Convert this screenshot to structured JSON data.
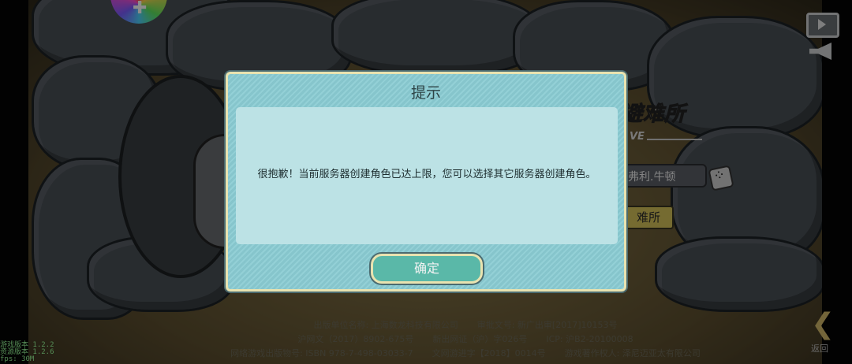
{
  "dialog": {
    "title": "提示",
    "message": "很抱歉！当前服务器创建角色已达上限，您可以选择其它服务器创建角色。",
    "confirm_label": "确定"
  },
  "background": {
    "logo_text": "避难所",
    "logo_sub": "VE",
    "name_value": "弗利.牛顿",
    "enter_button_label": "难所",
    "back_label": "返回"
  },
  "credits": {
    "publisher": "出版单位名称: 上海数龙科技有限公司",
    "approval": "审批文号: 新广出审[2017]10153号",
    "culture_license": "沪网文（2017）8902-675号",
    "publication_license": "新出网证（沪）字026号",
    "icp": "ICP: 沪B2-20100008",
    "isbn": "网络游戏出版物号: ISBN 978-7-498-03033-7",
    "game_culture": "文网游进字【2018】0014号",
    "copyright_owner": "游戏著作权人: 泽尼迈亚太有限公司"
  },
  "debug": {
    "game_version": "游戏版本 1.2.2",
    "resource_version": "资源版本 1.2.6",
    "fps": "fps: 30M"
  },
  "icons": {
    "wheel": "color-wheel-icon",
    "video": "video-ad-icon",
    "announce": "megaphone-icon",
    "back": "back-arrow-icon",
    "dice": "dice-icon"
  }
}
